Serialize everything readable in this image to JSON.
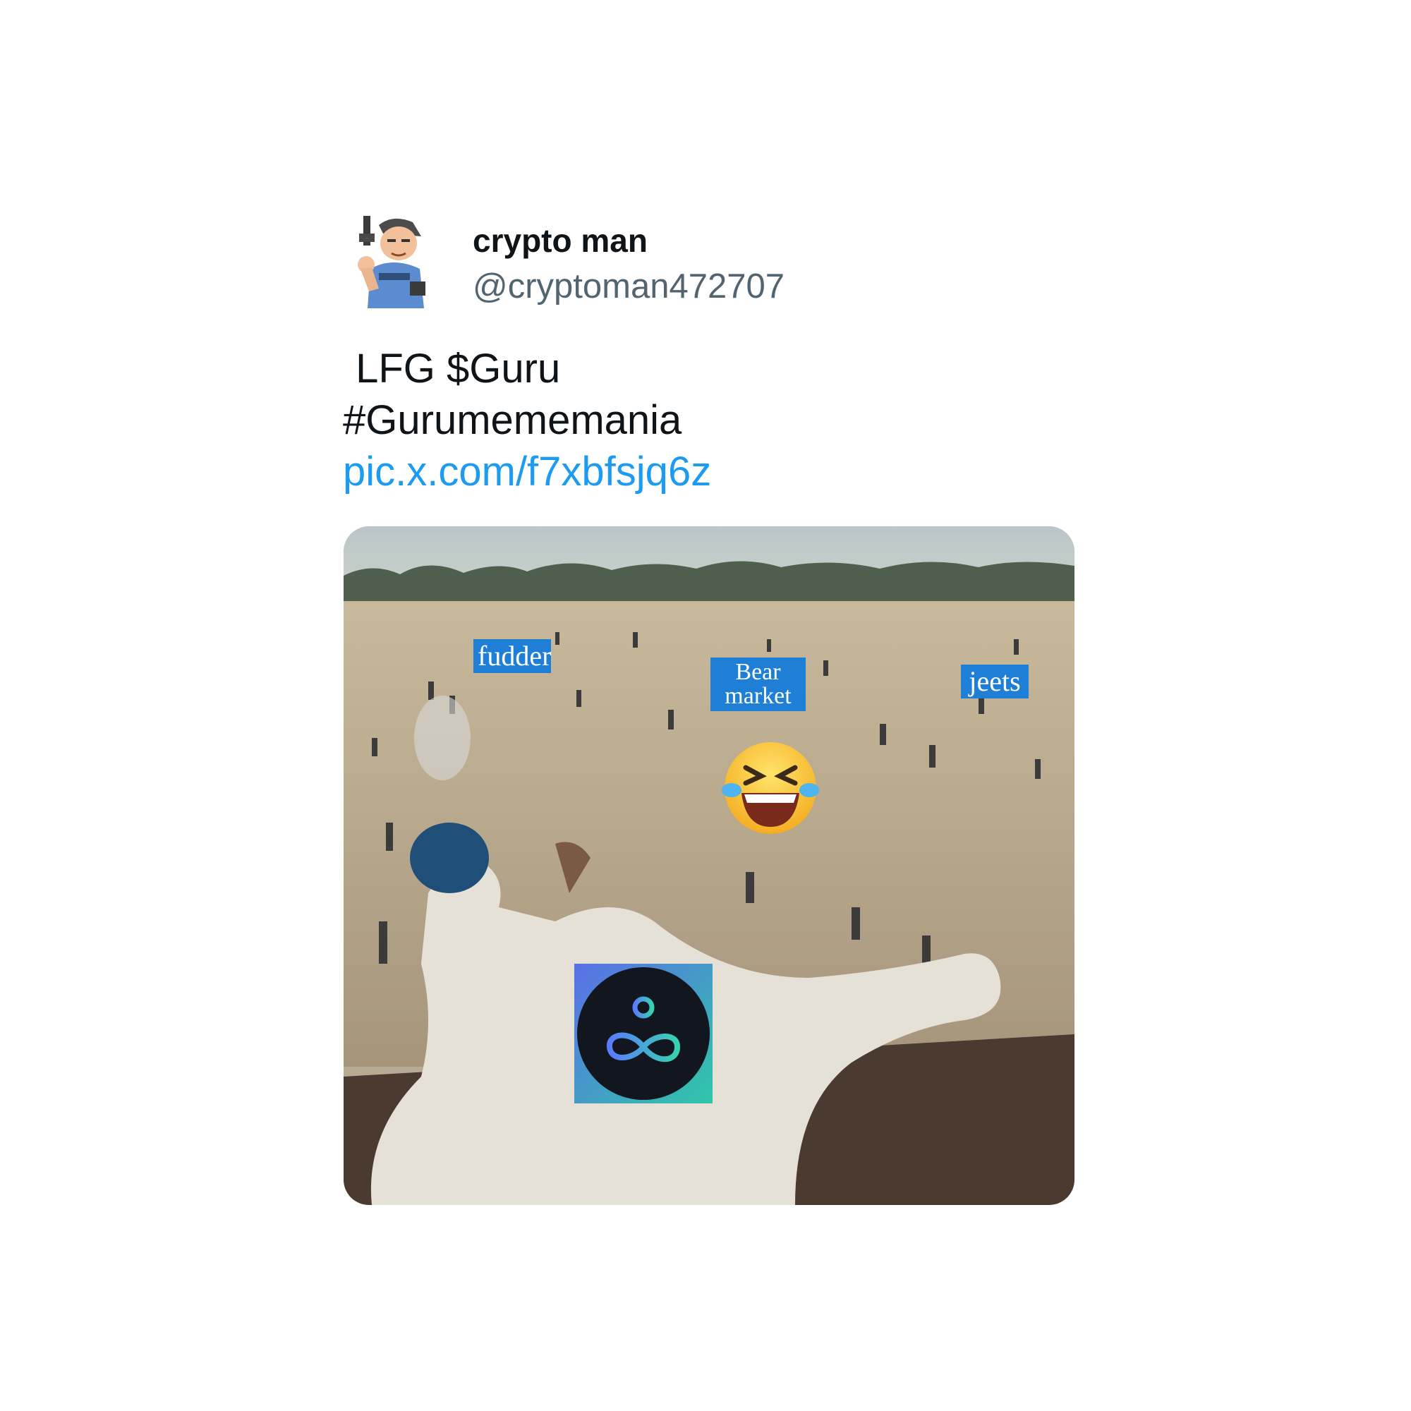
{
  "author": {
    "name": "crypto man",
    "handle": "@cryptoman472707",
    "avatar_icon": "cartoon-gunman-avatar-icon"
  },
  "tweet": {
    "line1": " LFG $Guru",
    "line2": "#Gurumememania",
    "link": "pic.x.com/f7xbfsjq6z"
  },
  "media": {
    "labels": {
      "fudder": "fudder",
      "bear_line1": "Bear",
      "bear_line2": "market",
      "jeets": "jeets"
    },
    "emoji": "😆",
    "overlay_logo_icon": "guru-infinity-logo-icon"
  },
  "colors": {
    "link": "#1d9bf0",
    "handle": "#536471",
    "label_bg": "#1f7fd6"
  }
}
